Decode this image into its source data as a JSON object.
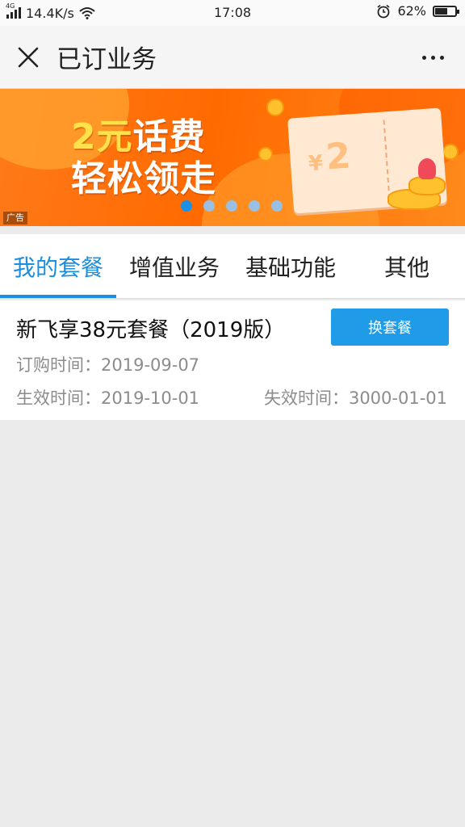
{
  "status_bar": {
    "network": "4G",
    "speed": "14.4K/s",
    "time": "17:08",
    "battery": "62%",
    "battery_level": 0.62
  },
  "header": {
    "title": "已订业务"
  },
  "banner": {
    "line1_highlight": "2元",
    "line1_rest": "话费",
    "line2": "轻松领走",
    "ticket_currency": "¥",
    "ticket_amount": "2",
    "ad_label": "广告",
    "slide_count": 5,
    "active_slide": 0
  },
  "tabs": [
    {
      "label": "我的套餐",
      "active": true
    },
    {
      "label": "增值业务",
      "active": false
    },
    {
      "label": "基础功能",
      "active": false
    },
    {
      "label": "其他",
      "active": false
    }
  ],
  "plan": {
    "name": "新飞享38元套餐（2019版）",
    "switch_label": "换套餐",
    "order_time_label": "订购时间：",
    "order_time": "2019-09-07",
    "effective_label": "生效时间：",
    "effective_time": "2019-10-01",
    "expire_label": "失效时间：",
    "expire_time": "3000-01-01"
  },
  "colors": {
    "accent": "#1a8fe0",
    "button": "#1f9be8",
    "banner": "#ff6a00"
  }
}
